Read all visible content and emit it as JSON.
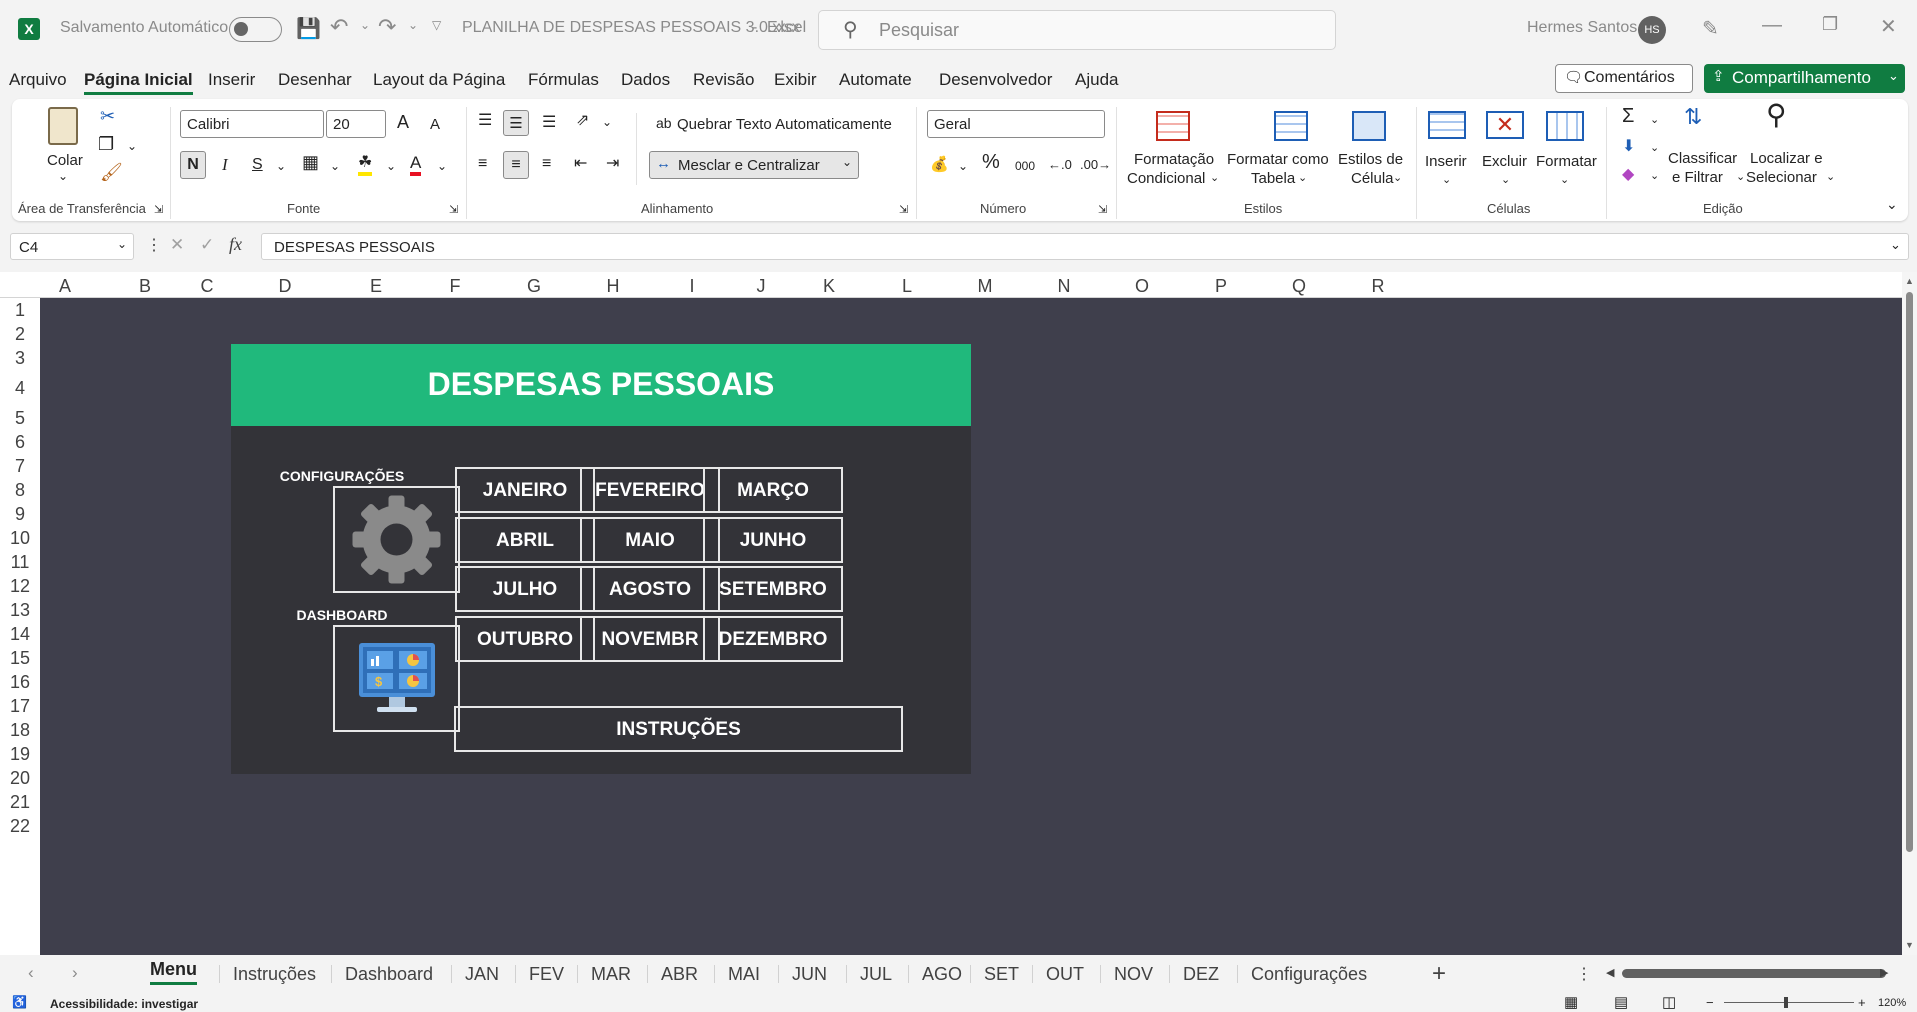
{
  "titlebar": {
    "autosave_label": "Salvamento Automático",
    "file_name": "PLANILHA DE DESPESAS PESSOAIS 3.0.xlsx",
    "app_sep": "-",
    "app_name": "Excel",
    "search_placeholder": "Pesquisar",
    "user_name": "Hermes Santos",
    "user_initials": "HS"
  },
  "menu": {
    "items": [
      "Arquivo",
      "Página Inicial",
      "Inserir",
      "Desenhar",
      "Layout da Página",
      "Fórmulas",
      "Dados",
      "Revisão",
      "Exibir",
      "Automate",
      "Desenvolvedor",
      "Ajuda"
    ],
    "active": "Página Inicial",
    "comments_label": "Comentários",
    "share_label": "Compartilhamento"
  },
  "ribbon": {
    "clipboard": {
      "paste": "Colar",
      "group": "Área de Transferência"
    },
    "font": {
      "name": "Calibri",
      "size": "20",
      "bold": "N",
      "italic": "I",
      "strike": "S",
      "color_a": "A",
      "grow": "A",
      "shrink": "A",
      "group": "Fonte"
    },
    "alignment": {
      "wrap": "Quebrar Texto Automaticamente",
      "merge": "Mesclar e Centralizar",
      "group": "Alinhamento"
    },
    "number": {
      "format": "Geral",
      "percent": "%",
      "thousands": "000",
      "group": "Número"
    },
    "styles": {
      "conditional_1": "Formatação",
      "conditional_2": "Condicional",
      "table_1": "Formatar como",
      "table_2": "Tabela",
      "cell_1": "Estilos de",
      "cell_2": "Célula",
      "group": "Estilos"
    },
    "cells": {
      "insert": "Inserir",
      "delete": "Excluir",
      "format": "Formatar",
      "group": "Células"
    },
    "editing": {
      "sort_1": "Classificar",
      "sort_2": "e Filtrar",
      "find_1": "Localizar e",
      "find_2": "Selecionar",
      "group": "Edição"
    }
  },
  "formula_bar": {
    "name_box": "C4",
    "fx": "fx",
    "value": "DESPESAS PESSOAIS"
  },
  "columns": [
    "A",
    "B",
    "C",
    "D",
    "E",
    "F",
    "G",
    "H",
    "I",
    "J",
    "K",
    "L",
    "M",
    "N",
    "O",
    "P",
    "Q",
    "R"
  ],
  "rows": [
    "1",
    "2",
    "3",
    "4",
    "5",
    "6",
    "7",
    "8",
    "9",
    "10",
    "11",
    "12",
    "13",
    "14",
    "15",
    "16",
    "17",
    "18",
    "19",
    "20",
    "21",
    "22"
  ],
  "dashboard": {
    "title": "DESPESAS PESSOAIS",
    "config_label": "CONFIGURAÇÕES",
    "dashboard_label": "DASHBOARD",
    "months": [
      "JANEIRO",
      "FEVEREIRO",
      "MARÇO",
      "ABRIL",
      "MAIO",
      "JUNHO",
      "JULHO",
      "AGOSTO",
      "SETEMBRO",
      "OUTUBRO",
      "NOVEMBR",
      "DEZEMBRO"
    ],
    "instructions": "INSTRUÇÕES",
    "colors": {
      "banner": "#20b97c",
      "panel": "#333338",
      "sheet": "#3f3f4c"
    }
  },
  "sheet_tabs": {
    "items": [
      "Menu",
      "Instruções",
      "Dashboard",
      "JAN",
      "FEV",
      "MAR",
      "ABR",
      "MAI",
      "JUN",
      "JUL",
      "AGO",
      "SET",
      "OUT",
      "NOV",
      "DEZ",
      "Configurações"
    ],
    "active": "Menu",
    "add": "+"
  },
  "status": {
    "accessibility": "Acessibilidade: investigar",
    "zoom": "120%"
  }
}
